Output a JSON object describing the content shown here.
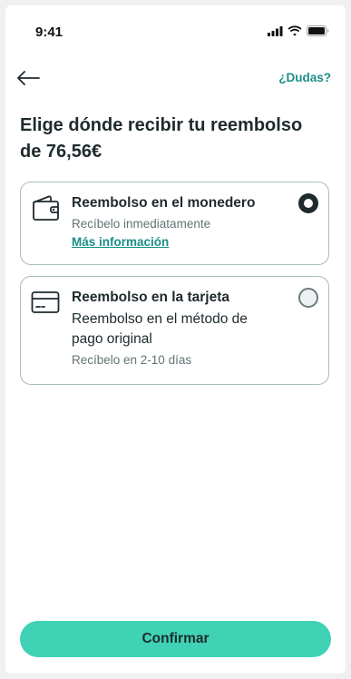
{
  "status_bar": {
    "time": "9:41"
  },
  "header": {
    "back_icon": "arrow-left-icon",
    "help_label": "¿Dudas?"
  },
  "title": "Elige dónde recibir tu reembolso de 76,56€",
  "options": [
    {
      "icon": "wallet-icon",
      "title": "Reembolso en el monedero",
      "subtitle": "Recíbelo inmediatamente",
      "link": "Más información",
      "selected": true
    },
    {
      "icon": "credit-card-icon",
      "title": "Reembolso en la tarjeta",
      "description": "Reembolso en el método de pago original",
      "subtitle": "Recíbelo en 2-10 días",
      "selected": false
    }
  ],
  "confirm_label": "Confirmar",
  "colors": {
    "accent": "#1a8f86",
    "button": "#3fd2b4",
    "text": "#1f2a2e",
    "muted": "#647377",
    "border": "#a9bcbc"
  }
}
